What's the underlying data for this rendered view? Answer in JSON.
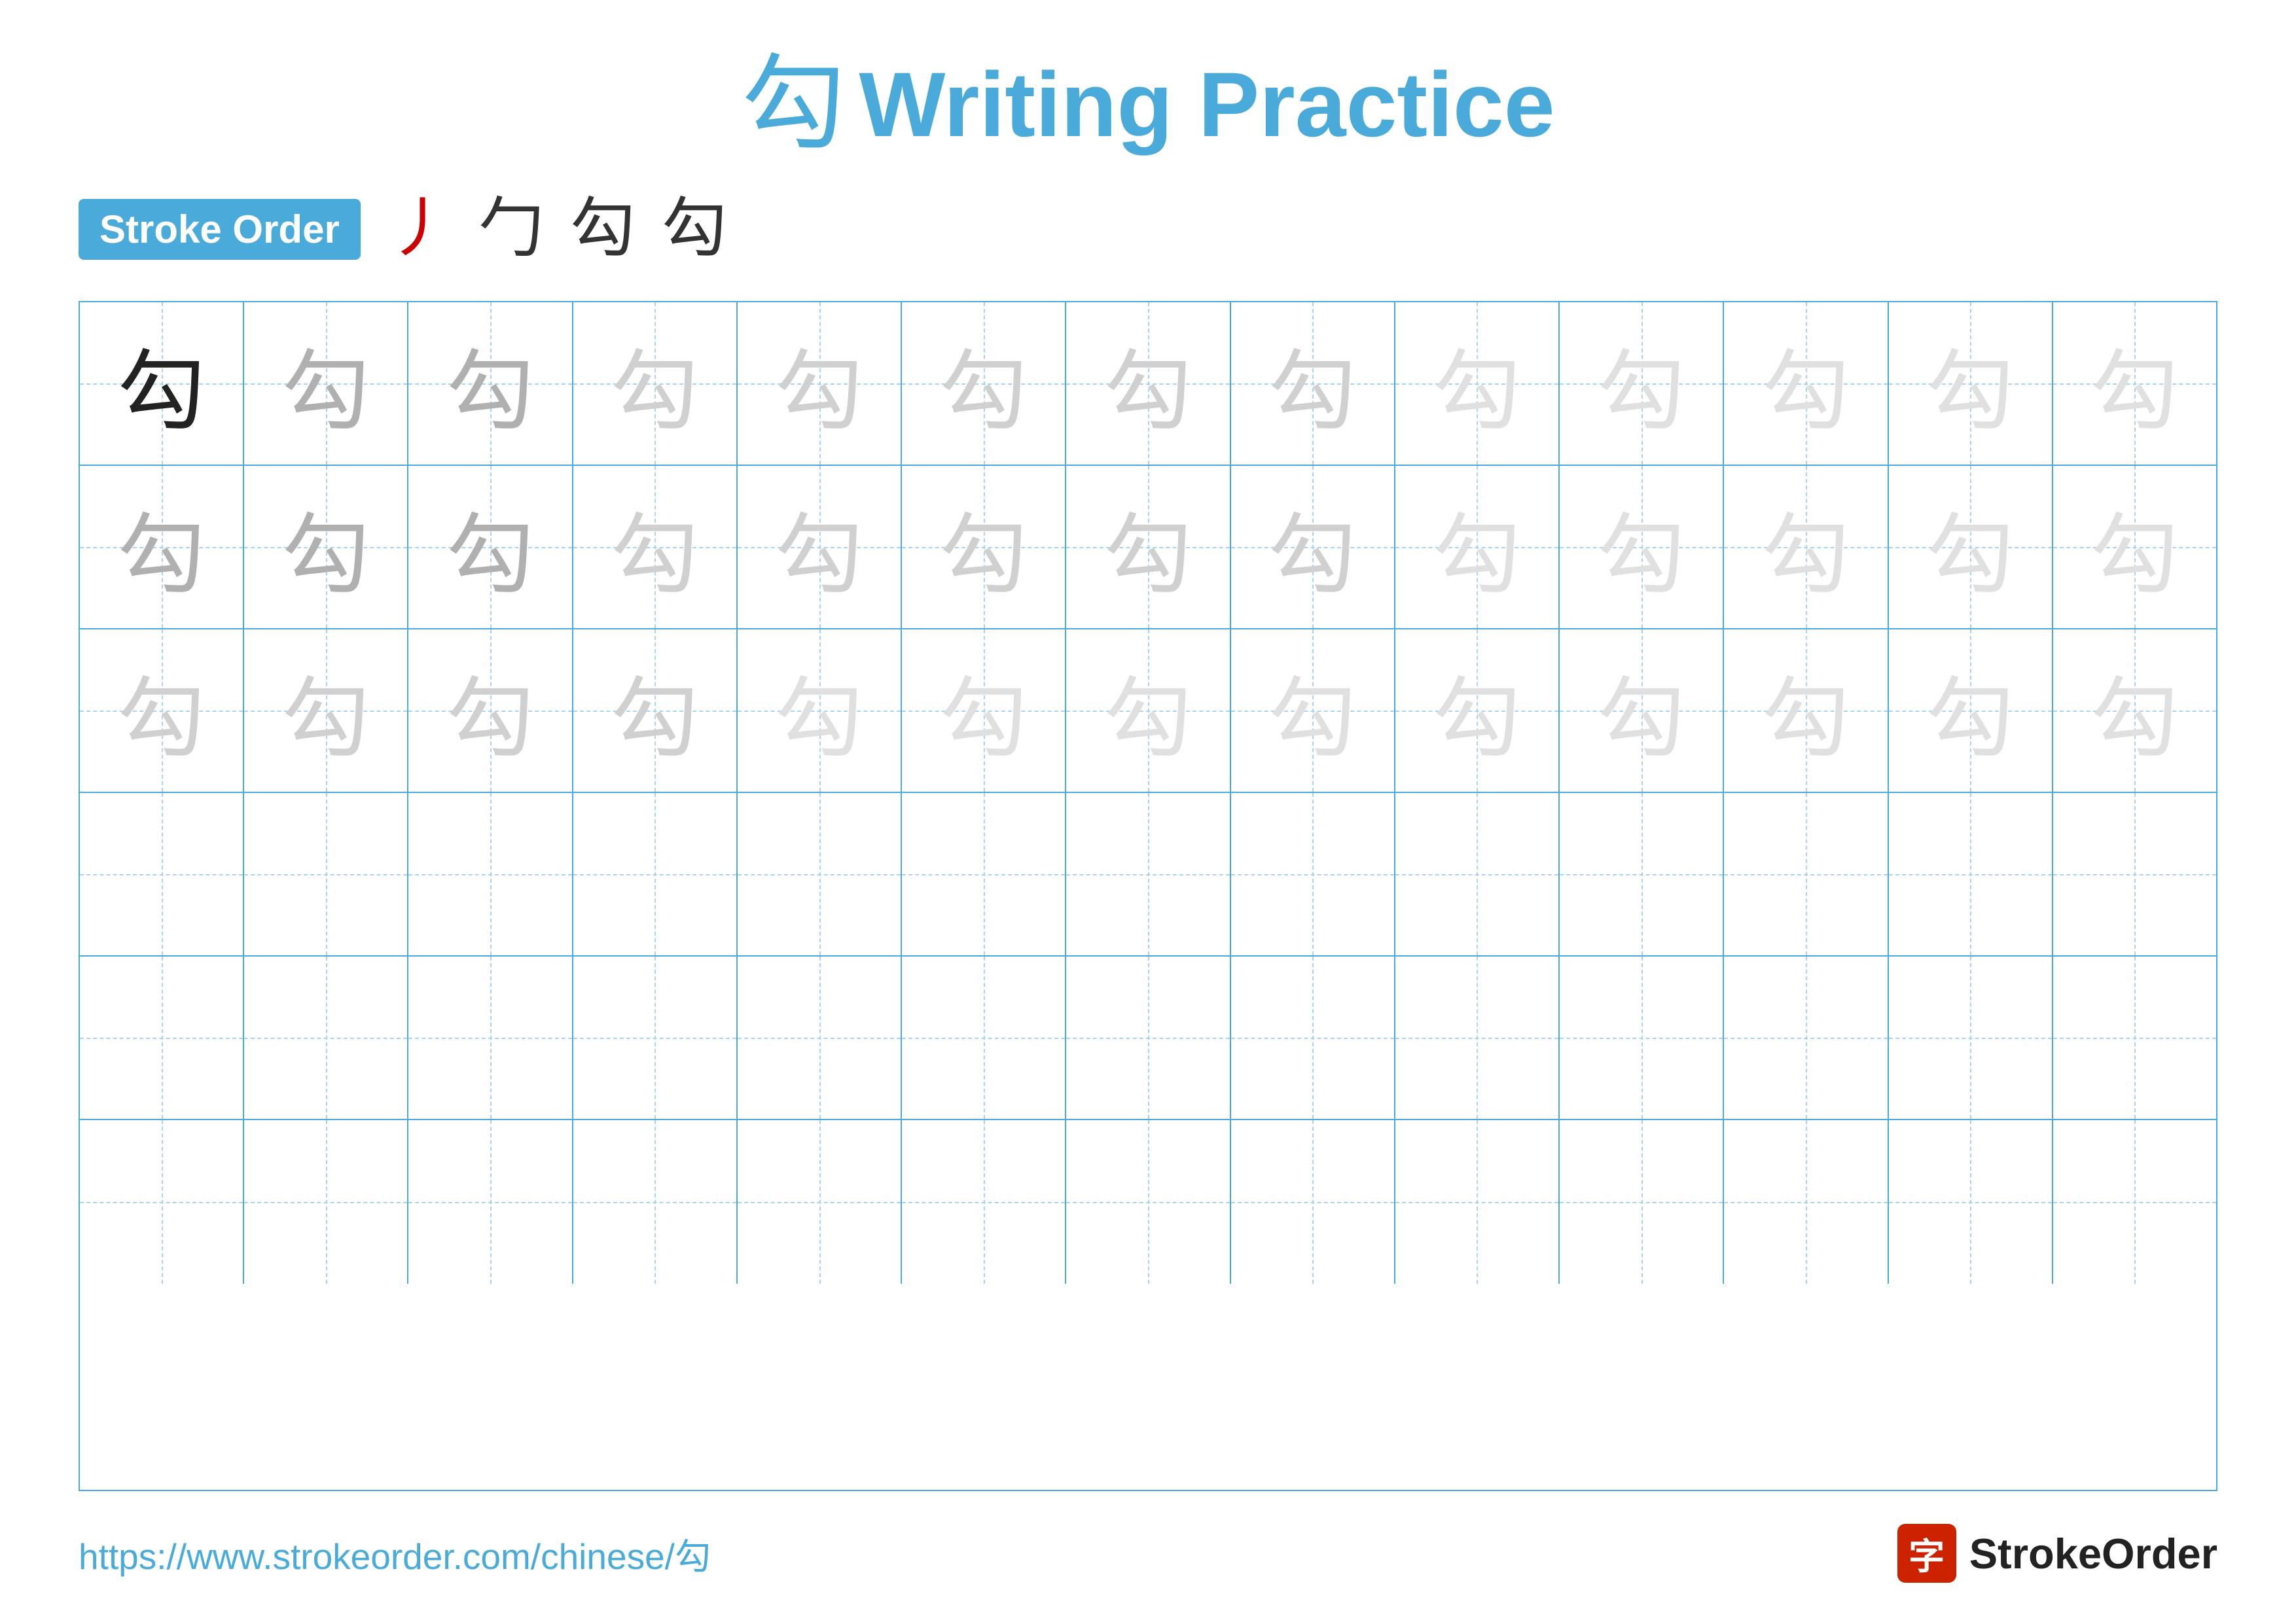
{
  "title": {
    "char": "勾",
    "text": "Writing Practice"
  },
  "stroke_order": {
    "badge_label": "Stroke Order",
    "steps": [
      "丿",
      "勹",
      "勾",
      "勾"
    ]
  },
  "grid": {
    "rows": 6,
    "cols": 13,
    "char": "勾",
    "row_types": [
      "solid_then_dark",
      "dark_gray",
      "light_gray",
      "empty",
      "empty",
      "empty"
    ]
  },
  "footer": {
    "url": "https://www.strokeorder.com/chinese/勾",
    "logo_char": "字",
    "logo_text": "StrokeOrder"
  }
}
